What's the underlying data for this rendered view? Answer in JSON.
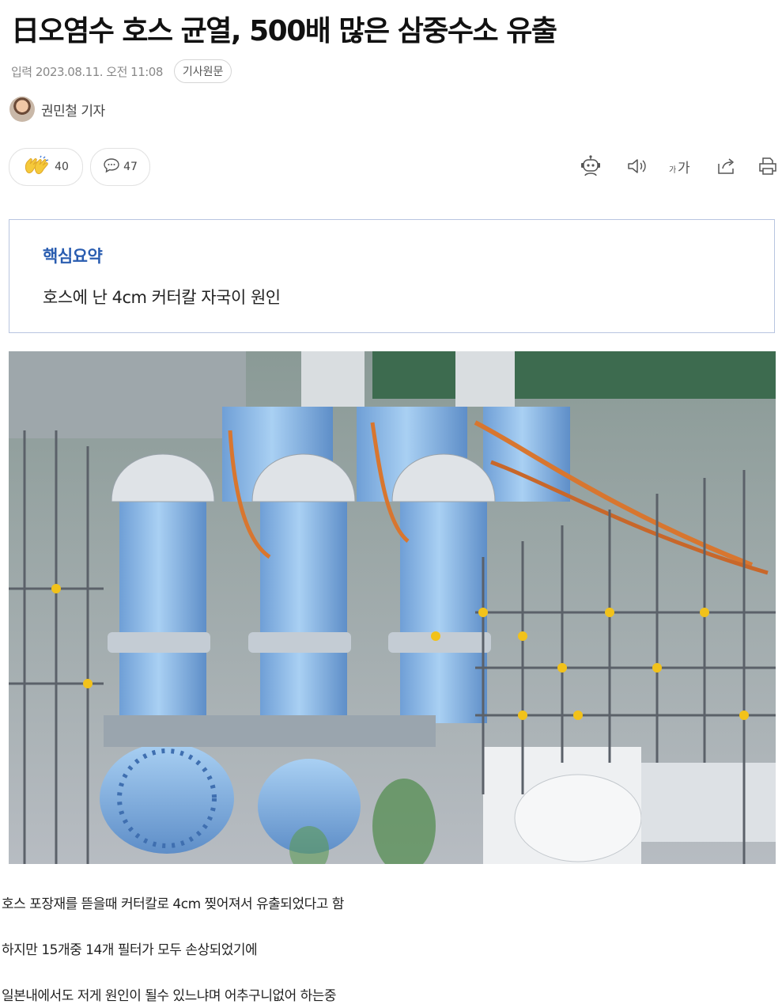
{
  "article": {
    "title": "日오염수 호스 균열, 500배 많은 삼중수소 유출",
    "meta_text": "입력 2023.08.11. 오전 11:08",
    "original_button": "기사원문",
    "author": "권민철 기자"
  },
  "actions": {
    "reaction_count": "40",
    "comment_count": "47",
    "font_size_label": "가가"
  },
  "summary": {
    "heading": "핵심요약",
    "text": "호스에 난 4cm 커터칼 자국이 원인"
  },
  "body": {
    "lines": [
      "호스 포장재를 뜯을때 커터칼로 4cm 찢어져서 유출되었다고 함",
      "하지만 15개중 14개 필터가 모두 손상되었기에",
      "일본내에서도 저게 원인이 될수 있느냐며 어추구니없어 하는중"
    ]
  },
  "colors": {
    "accent_blue": "#2a5db0",
    "summary_border": "#b8c5e0",
    "pipe_blue": "#8fbde9"
  },
  "icons": [
    "clap-icon",
    "speech-bubble-icon",
    "robot-icon",
    "speaker-icon",
    "font-size-icon",
    "share-icon",
    "print-icon"
  ]
}
